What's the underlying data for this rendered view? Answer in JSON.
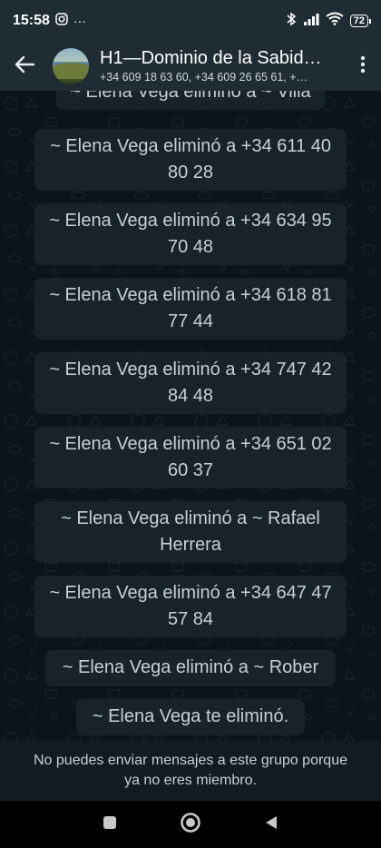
{
  "status_bar": {
    "time": "15:58",
    "more": "···",
    "battery": "72"
  },
  "header": {
    "title": "H1—Dominio de la Sabid…",
    "subtitle": "+34 609 18 63 60, +34 609 26 65 61, +…"
  },
  "messages": [
    "~ Elena Vega eliminó a ~ Villa",
    "~ Elena Vega eliminó a +34 611 40 80 28",
    "~ Elena Vega eliminó a +34 634 95 70 48",
    "~ Elena Vega eliminó a +34 618 81 77 44",
    "~ Elena Vega eliminó a +34 747 42 84 48",
    "~ Elena Vega eliminó a +34 651 02 60 37",
    "~ Elena Vega eliminó a ~ Rafael Herrera",
    "~ Elena Vega eliminó a +34 647 47 57 84",
    "~ Elena Vega eliminó a ~ Rober",
    "~ Elena Vega te eliminó."
  ],
  "footer": {
    "notice": "No puedes enviar mensajes a este grupo porque ya no eres miembro."
  },
  "icons": {
    "back": "arrow-left-icon",
    "menu": "more-vert-icon",
    "nav_recents": "square-icon",
    "nav_home": "circle-icon",
    "nav_back": "triangle-back-icon"
  },
  "colors": {
    "header_bg": "#1f2c34",
    "chat_bg": "#0b141a",
    "bubble_bg": "#182229",
    "footer_bg": "#111b21"
  }
}
